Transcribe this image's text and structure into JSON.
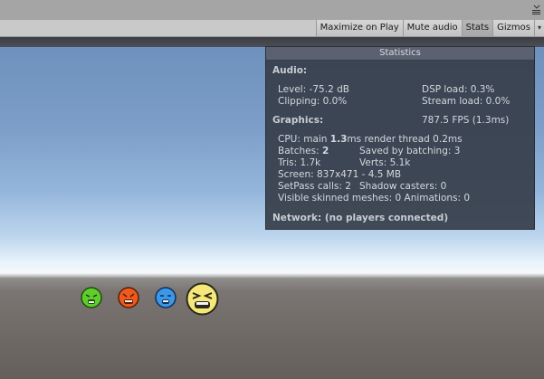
{
  "toolbar": {
    "maximize_label": "Maximize on Play",
    "mute_label": "Mute audio",
    "stats_label": "Stats",
    "gizmos_label": "Gizmos",
    "dropdown_label": "▾"
  },
  "stats": {
    "title": "Statistics",
    "audio_header": "Audio:",
    "level": "Level: -75.2 dB",
    "clipping": "Clipping: 0.0%",
    "dsp_load": "DSP load: 0.3%",
    "stream_load": "Stream load: 0.0%",
    "graphics_header": "Graphics:",
    "fps": "787.5 FPS (1.3ms)",
    "cpu_prefix": "CPU: main ",
    "cpu_main": "1.3",
    "cpu_suffix": "ms  render thread 0.2ms",
    "batches_prefix": "Batches: ",
    "batches_value": "2",
    "saved_batching": "Saved by batching: 3",
    "tris": "Tris: 1.7k",
    "verts": "Verts: 5.1k",
    "screen": "Screen: 837x471 - 4.5 MB",
    "setpass": "SetPass calls: 2",
    "shadow_casters": "Shadow casters: 0",
    "skinned": "Visible skinned meshes: 0  Animations: 0",
    "network": "Network: (no players connected)"
  },
  "colors": {
    "green_face": "#5fce2c",
    "red_face": "#ec5a1e",
    "blue_face": "#3c97e6",
    "yellow_face": "#f6e77a"
  },
  "icons": [
    "hamburger-menu-icon",
    "green-face-sprite",
    "red-face-sprite",
    "blue-face-sprite",
    "yellow-face-sprite"
  ]
}
